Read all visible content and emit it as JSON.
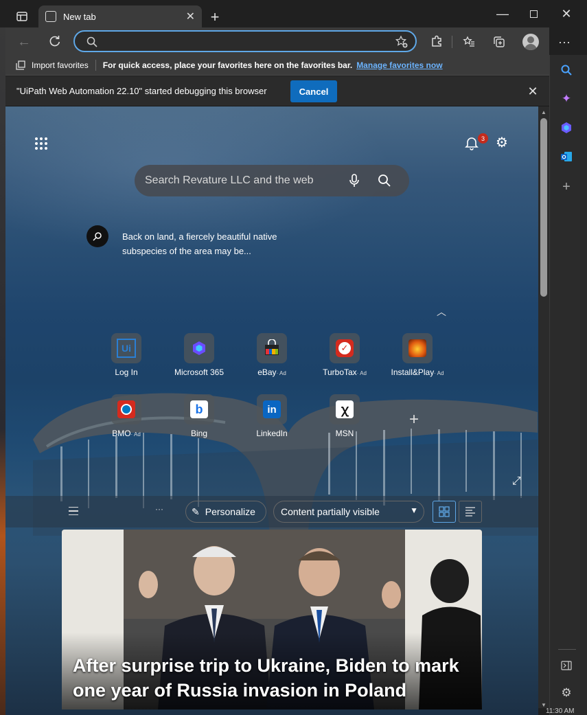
{
  "browser": {
    "tab_title": "New tab",
    "favbar": {
      "import_label": "Import favorites",
      "hint": "For quick access, place your favorites here on the favorites bar.",
      "manage_link": "Manage favorites now"
    },
    "debug": {
      "message": "\"UiPath Web Automation 22.10\" started debugging this browser",
      "cancel_label": "Cancel"
    }
  },
  "newtab": {
    "notifications_count": "3",
    "search_placeholder": "Search Revature LLC and the web",
    "image_caption": "Back on land, a fiercely beautiful native subspecies of the area may be...",
    "tiles": [
      {
        "label": "Log In",
        "ad": "",
        "icon": "uipath-icon"
      },
      {
        "label": "Microsoft 365",
        "ad": "",
        "icon": "microsoft-365-icon"
      },
      {
        "label": "eBay",
        "ad": "· Ad",
        "icon": "ebay-icon"
      },
      {
        "label": "TurboTax",
        "ad": "· Ad",
        "icon": "turbotax-icon"
      },
      {
        "label": "Install&Play",
        "ad": "· Ad",
        "icon": "install-play-icon"
      },
      {
        "label": "BMO",
        "ad": "· Ad",
        "icon": "bmo-icon"
      },
      {
        "label": "Bing",
        "ad": "",
        "icon": "bing-icon"
      },
      {
        "label": "LinkedIn",
        "ad": "",
        "icon": "linkedin-icon"
      },
      {
        "label": "MSN",
        "ad": "",
        "icon": "msn-icon"
      }
    ],
    "feed": {
      "personalize_label": "Personalize",
      "visibility_select": "Content partially visible",
      "more_label": "···"
    },
    "headline": "After surprise trip to Ukraine, Biden to mark one year of Russia invasion in Poland"
  },
  "taskbar_time": "11:30 AM",
  "colors": {
    "accent": "#5fa8e8",
    "button_blue": "#0f6cbd",
    "badge_red": "#c42b1c"
  }
}
